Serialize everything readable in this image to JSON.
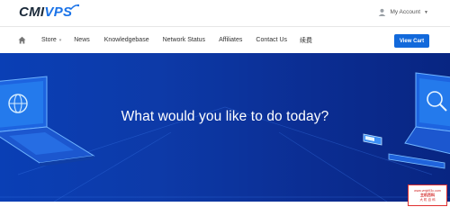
{
  "logo": {
    "text_a": "CMI",
    "text_b": "VPS"
  },
  "account": {
    "label": "My Account"
  },
  "nav": {
    "items": [
      {
        "label": "Store",
        "has_dropdown": true
      },
      {
        "label": "News"
      },
      {
        "label": "Knowledgebase"
      },
      {
        "label": "Network Status"
      },
      {
        "label": "Affiliates"
      },
      {
        "label": "Contact Us"
      },
      {
        "label": "续费"
      }
    ],
    "cart_label": "View Cart"
  },
  "hero": {
    "title": "What would you like to do today?"
  },
  "watermark": {
    "line1": "www.vmjd93c.com",
    "line2": "主机百科",
    "line3": "大 机 百 科"
  },
  "colors": {
    "accent": "#1269db",
    "hero_bg": "#0b2d92",
    "stamp": "#d02020"
  },
  "icons": [
    "home-icon",
    "user-icon",
    "caret-down-icon"
  ]
}
